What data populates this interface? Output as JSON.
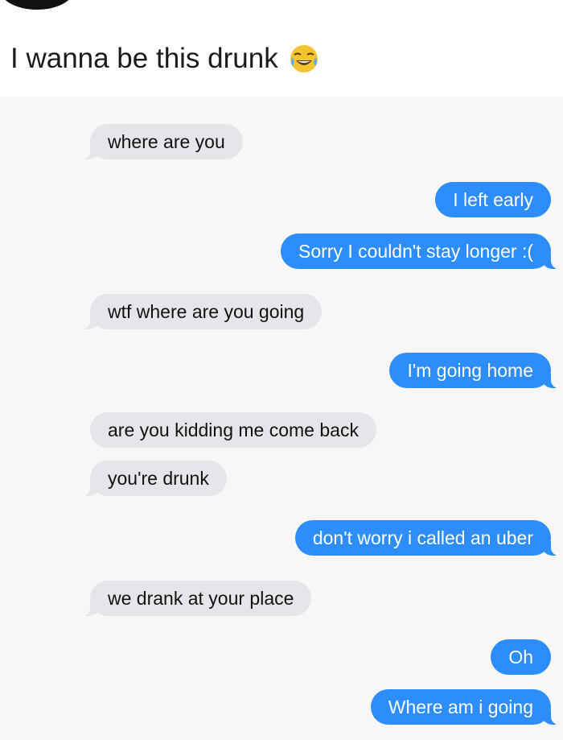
{
  "post": {
    "caption": "I wanna be this drunk",
    "caption_emoji": "face-with-tears-of-joy-icon"
  },
  "colors": {
    "incoming_bubble": "#e6e6ea",
    "outgoing_bubble": "#2d8dfb",
    "outgoing_text": "#ffffff"
  },
  "messages": [
    {
      "from": "them",
      "text": "where are you"
    },
    {
      "from": "me",
      "text": "I left early"
    },
    {
      "from": "me",
      "text": "Sorry I couldn't stay longer :("
    },
    {
      "from": "them",
      "text": "wtf where are you going"
    },
    {
      "from": "me",
      "text": "I'm going home"
    },
    {
      "from": "them",
      "text": "are you kidding me come back"
    },
    {
      "from": "them",
      "text": "you're drunk"
    },
    {
      "from": "me",
      "text": "don't worry i called an uber"
    },
    {
      "from": "them",
      "text": "we drank at your place"
    },
    {
      "from": "me",
      "text": "Oh"
    },
    {
      "from": "me",
      "text": "Where am i going"
    }
  ]
}
